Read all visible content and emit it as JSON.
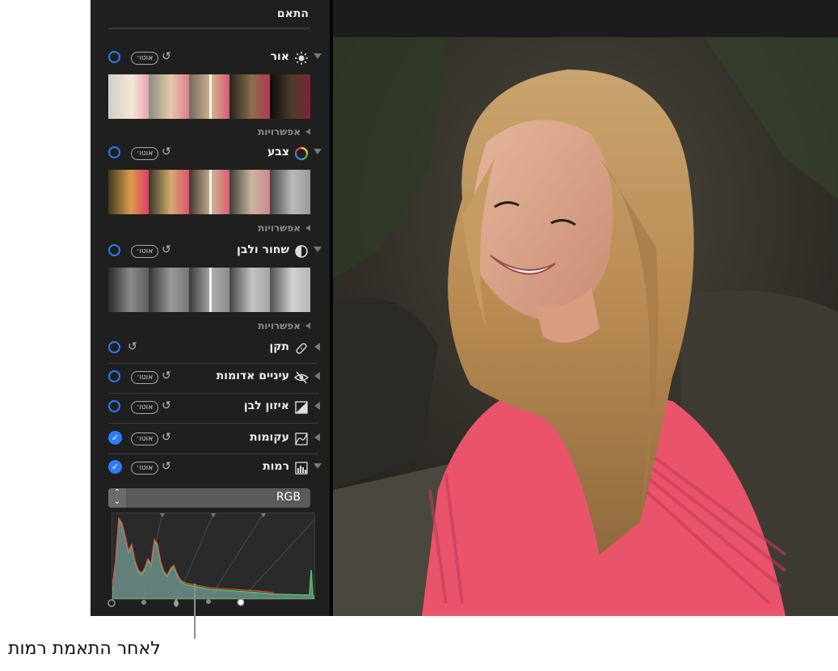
{
  "panel": {
    "title": "התאם"
  },
  "sections": {
    "light": {
      "label": "אור",
      "auto": "אוטו׳",
      "undo": "↺",
      "options": "אפשרויות"
    },
    "color": {
      "label": "צבע",
      "auto": "אוטו׳",
      "undo": "↺",
      "options": "אפשרויות"
    },
    "bw": {
      "label": "שחור ולבן",
      "auto": "אוטו׳",
      "undo": "↺",
      "options": "אפשרויות"
    },
    "retouch": {
      "label": "תקן",
      "undo": "↺"
    },
    "redeye": {
      "label": "עיניים אדומות",
      "auto": "אוטו׳",
      "undo": "↺"
    },
    "whitebalance": {
      "label": "איזון לבן",
      "auto": "אוטו׳",
      "undo": "↺"
    },
    "curves": {
      "label": "עקומות",
      "auto": "אוטו׳",
      "undo": "↺",
      "enabled": true
    },
    "levels": {
      "label": "רמות",
      "auto": "אוטו׳",
      "undo": "↺",
      "enabled": true
    }
  },
  "levels": {
    "channel": "RGB"
  },
  "caption": "לאחר התאמת רמות",
  "icons": {
    "light": "sun-icon",
    "color": "color-wheel-icon",
    "bw": "half-circle-icon",
    "retouch": "bandage-icon",
    "redeye": "eye-slash-icon",
    "whitebalance": "white-balance-icon",
    "curves": "curves-icon",
    "levels": "histogram-icon"
  },
  "colors": {
    "accent": "#2f7cf6",
    "panel_bg": "#1f1f1f",
    "shirt": "#e9546b"
  }
}
